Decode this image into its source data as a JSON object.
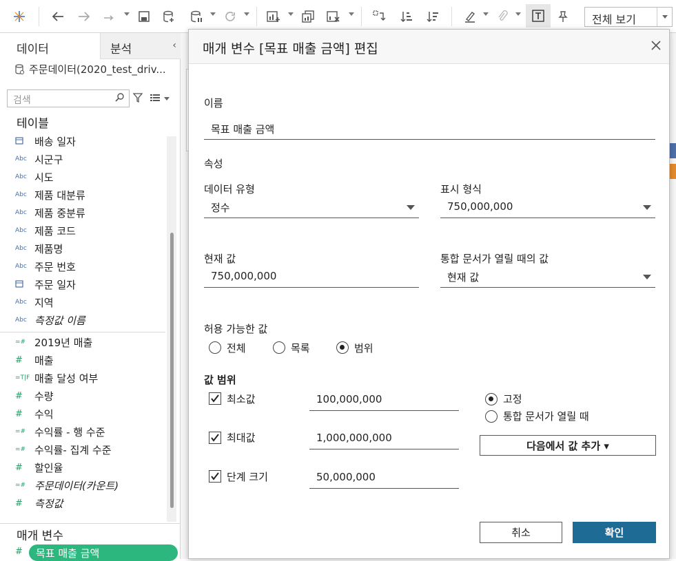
{
  "toolbar": {
    "view_select": "전체 보기"
  },
  "left_pane": {
    "tab_data": "데이터",
    "tab_analysis": "분석",
    "datasource": "주문데이터(2020_test_driv...",
    "search_placeholder": "검색",
    "tables_title": "테이블",
    "dimensions": [
      {
        "type": "date",
        "label": "배송 일자"
      },
      {
        "type": "Abc",
        "label": "시군구"
      },
      {
        "type": "Abc",
        "label": "시도"
      },
      {
        "type": "Abc",
        "label": "제품 대분류"
      },
      {
        "type": "Abc",
        "label": "제품 중분류"
      },
      {
        "type": "Abc",
        "label": "제품 코드"
      },
      {
        "type": "Abc",
        "label": "제품명"
      },
      {
        "type": "Abc",
        "label": "주문 번호"
      },
      {
        "type": "date",
        "label": "주문 일자"
      },
      {
        "type": "Abc",
        "label": "지역"
      },
      {
        "type": "Abc",
        "label": "측정값 이름"
      }
    ],
    "measures": [
      {
        "type": "=#",
        "label": "2019년 매출"
      },
      {
        "type": "#",
        "label": "매출"
      },
      {
        "type": "=T|F",
        "label": "매출 달성 여부"
      },
      {
        "type": "#",
        "label": "수량"
      },
      {
        "type": "#",
        "label": "수익"
      },
      {
        "type": "=#",
        "label": "수익률 - 행 수준"
      },
      {
        "type": "=#",
        "label": "수익률- 집계 수준"
      },
      {
        "type": "#",
        "label": "할인율"
      },
      {
        "type": "=#",
        "label": "주문데이터(카운트)"
      },
      {
        "type": "#",
        "label": "측정값"
      }
    ],
    "params_title": "매개 변수",
    "param_item": "목표 매출 금액"
  },
  "dialog": {
    "title": "매개 변수 [목표 매출 금액] 편집",
    "name_label": "이름",
    "name_value": "목표 매출 금액",
    "properties_label": "속성",
    "data_type_label": "데이터 유형",
    "data_type_value": "정수",
    "display_format_label": "표시 형식",
    "display_format_value": "750,000,000",
    "current_value_label": "현재 값",
    "current_value": "750,000,000",
    "open_value_label": "통합 문서가 열릴 때의 값",
    "open_value": "현재 값",
    "allowable_label": "허용 가능한 값",
    "allow_all": "전체",
    "allow_list": "목록",
    "allow_range": "범위",
    "range_label": "값 범위",
    "min_label": "최소값",
    "min_value": "100,000,000",
    "max_label": "최대값",
    "max_value": "1,000,000,000",
    "step_label": "단계 크기",
    "step_value": "50,000,000",
    "fixed_label": "고정",
    "on_open_label": "통합 문서가 열릴 때",
    "add_from_button": "다음에서 값 추가 ▾",
    "cancel_button": "취소",
    "ok_button": "확인"
  }
}
